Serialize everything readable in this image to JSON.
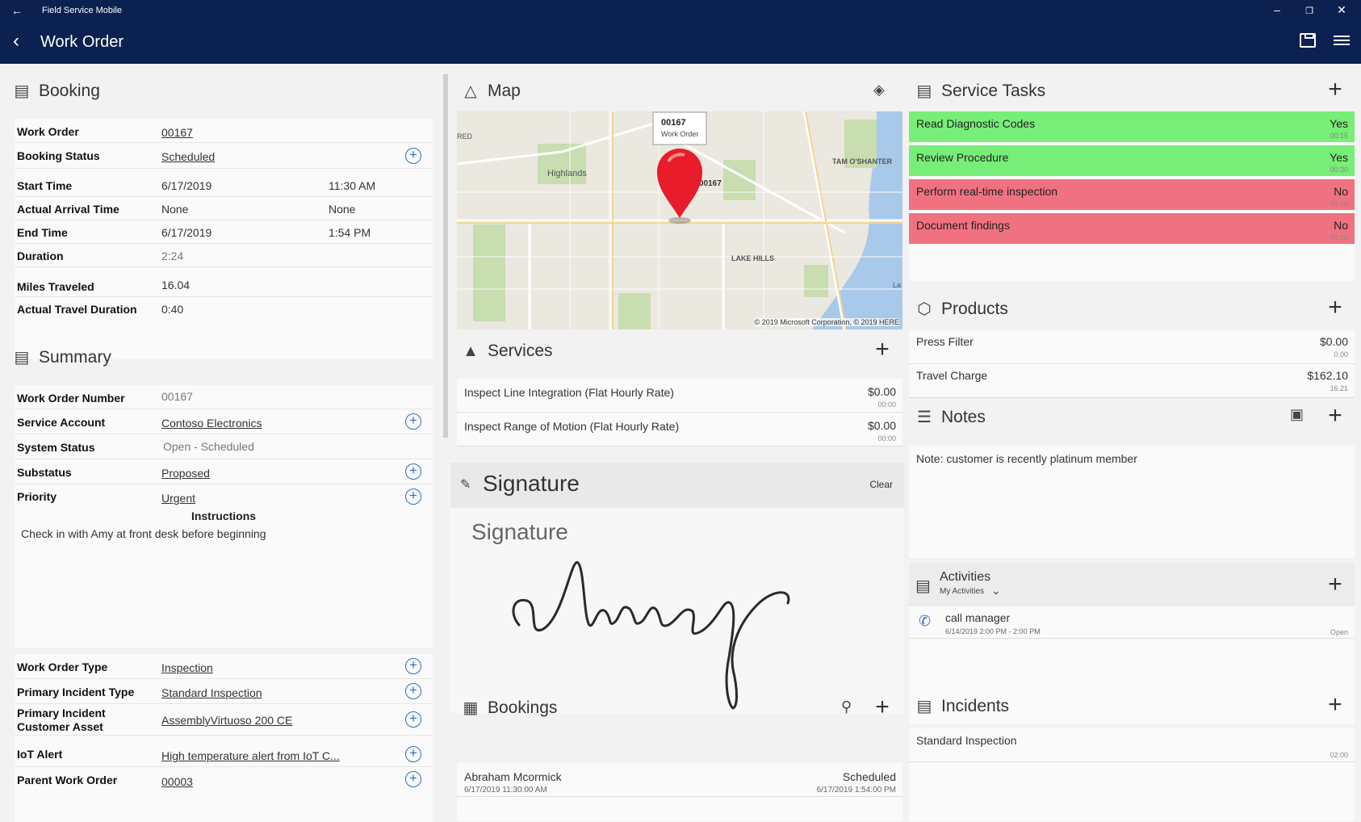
{
  "titlebar": {
    "app_name": "Field Service Mobile"
  },
  "header": {
    "title": "Work Order"
  },
  "booking": {
    "title": "Booking",
    "work_order_label": "Work Order",
    "work_order_value": "00167",
    "status_label": "Booking Status",
    "status_value": "Scheduled",
    "start_label": "Start Time",
    "start_date": "6/17/2019",
    "start_time": "11:30 AM",
    "arrival_label": "Actual Arrival Time",
    "arrival_date": "None",
    "arrival_time": "None",
    "end_label": "End Time",
    "end_date": "6/17/2019",
    "end_time": "1:54 PM",
    "duration_label": "Duration",
    "duration_value": "2:24",
    "miles_label": "Miles Traveled",
    "miles_value": "16.04",
    "travel_label": "Actual Travel Duration",
    "travel_value": "0:40"
  },
  "summary": {
    "title": "Summary",
    "won_label": "Work Order Number",
    "won_value": "00167",
    "account_label": "Service Account",
    "account_value": "Contoso Electronics",
    "sys_label": "System Status",
    "sys_value": "Open - Scheduled",
    "sub_label": "Substatus",
    "sub_value": "Proposed",
    "prio_label": "Priority",
    "prio_value": "Urgent",
    "instr_label": "Instructions",
    "instr_value": "Check in with Amy at front desk before beginning",
    "type_label": "Work Order Type",
    "type_value": "Inspection",
    "incident_label": "Primary Incident Type",
    "incident_value": "Standard Inspection",
    "asset_label": "Primary Incident Customer Asset",
    "asset_value": "AssemblyVirtuoso 200 CE",
    "iot_label": "IoT Alert",
    "iot_value": "High temperature alert from IoT C...",
    "parent_label": "Parent Work Order",
    "parent_value": "00003"
  },
  "map": {
    "title": "Map",
    "pin_title": "00167",
    "pin_sub": "Work Order",
    "pin_label": "00167",
    "labels": {
      "highlands": "Highlands",
      "tam": "TAM O'SHANTER",
      "lake": "LAKE HILLS",
      "red": "RED",
      "la": "La"
    },
    "copyright": "© 2019 Microsoft Corporation, © 2019 HERE"
  },
  "services": {
    "title": "Services",
    "items": [
      {
        "name": "Inspect Line Integration (Flat Hourly Rate)",
        "price": "$0.00",
        "dur": "00:00"
      },
      {
        "name": "Inspect Range of Motion (Flat Hourly Rate)",
        "price": "$0.00",
        "dur": "00:00"
      }
    ]
  },
  "signature": {
    "title": "Signature",
    "clear_label": "Clear",
    "pad_label": "Signature",
    "sign_text": "Amy"
  },
  "bookings": {
    "title": "Bookings",
    "items": [
      {
        "name": "Abraham Mcormick",
        "status": "Scheduled",
        "start": "6/17/2019 11:30:00 AM",
        "end": "6/17/2019 1:54:00 PM"
      }
    ]
  },
  "service_tasks": {
    "title": "Service Tasks",
    "items": [
      {
        "name": "Read Diagnostic Codes",
        "done": "Yes",
        "dur": "00:15",
        "color": "#77ee77"
      },
      {
        "name": "Review Procedure",
        "done": "Yes",
        "dur": "00:30",
        "color": "#77ee77"
      },
      {
        "name": "Perform real-time inspection",
        "done": "No",
        "dur": "01:00",
        "color": "#f07280"
      },
      {
        "name": "Document findings",
        "done": "No",
        "dur": "00:15",
        "color": "#f07280"
      }
    ]
  },
  "products": {
    "title": "Products",
    "items": [
      {
        "name": "Press Filter",
        "price": "$0.00",
        "qty": "0.00"
      },
      {
        "name": "Travel Charge",
        "price": "$162.10",
        "qty": "16.21"
      }
    ]
  },
  "notes": {
    "title": "Notes",
    "text": "Note: customer is recently platinum member"
  },
  "activities": {
    "title": "Activities",
    "filter": "My Activities",
    "items": [
      {
        "name": "call manager",
        "time": "6/14/2019 2:00 PM - 2:00 PM",
        "status": "Open"
      }
    ]
  },
  "incidents": {
    "title": "Incidents",
    "items": [
      {
        "name": "Standard Inspection",
        "dur": "02:00"
      }
    ]
  }
}
